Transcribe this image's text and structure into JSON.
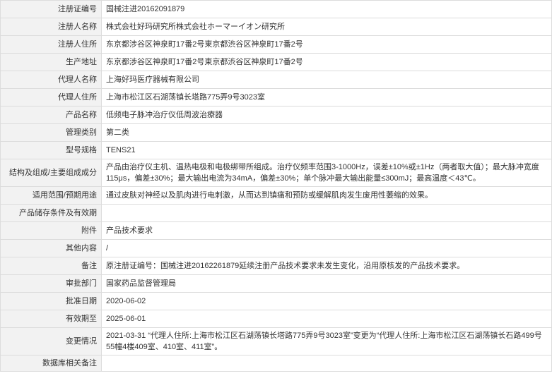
{
  "rows": [
    {
      "label": "注册证编号",
      "value": "国械注进20162091879"
    },
    {
      "label": "注册人名称",
      "value": "株式会社好玛研究所株式会社ホーマーイオン研究所"
    },
    {
      "label": "注册人住所",
      "value": "东京都涉谷区神泉町17番2号東京都渋谷区神泉町17番2号"
    },
    {
      "label": "生产地址",
      "value": "东京都涉谷区神泉町17番2号東京都渋谷区神泉町17番2号"
    },
    {
      "label": "代理人名称",
      "value": "上海好玛医疗器械有限公司"
    },
    {
      "label": "代理人住所",
      "value": "上海市松江区石湖荡镇长塔路775弄9号3023室"
    },
    {
      "label": "产品名称",
      "value": "低频电子脉冲治疗仪低周波治療器"
    },
    {
      "label": "管理类别",
      "value": "第二类"
    },
    {
      "label": "型号规格",
      "value": "TENS21"
    },
    {
      "label": "结构及组成/主要组成成分",
      "value": "产品由治疗仪主机、温热电极和电极绑带所组成。治疗仪频率范围3-1000Hz，误差±10%或±1Hz（两者取大值）；最大脉冲宽度115μs，偏差±30%；最大输出电流为34mA，偏差±30%；单个脉冲最大输出能量≤300mJ；最高温度＜43℃。"
    },
    {
      "label": "适用范围/预期用途",
      "value": "通过皮肤对神经以及肌肉进行电刺激，从而达到镇痛和预防或缓解肌肉发生废用性萎缩的效果。"
    },
    {
      "label": "产品储存条件及有效期",
      "value": ""
    },
    {
      "label": "附件",
      "value": "产品技术要求"
    },
    {
      "label": "其他内容",
      "value": "/"
    },
    {
      "label": "备注",
      "value": "原注册证编号：国械注进20162261879延续注册产品技术要求未发生变化，沿用原核发的产品技术要求。"
    },
    {
      "label": "审批部门",
      "value": "国家药品监督管理局"
    },
    {
      "label": "批准日期",
      "value": "2020-06-02"
    },
    {
      "label": "有效期至",
      "value": "2025-06-01"
    },
    {
      "label": "变更情况",
      "value": "2021-03-31 “代理人住所:上海市松江区石湖荡镇长塔路775弄9号3023室”变更为“代理人住所:上海市松江区石湖荡镇长石路499号55幢4楼409室、410室、411室”。"
    },
    {
      "label": "数据库相关备注",
      "value": ""
    }
  ]
}
